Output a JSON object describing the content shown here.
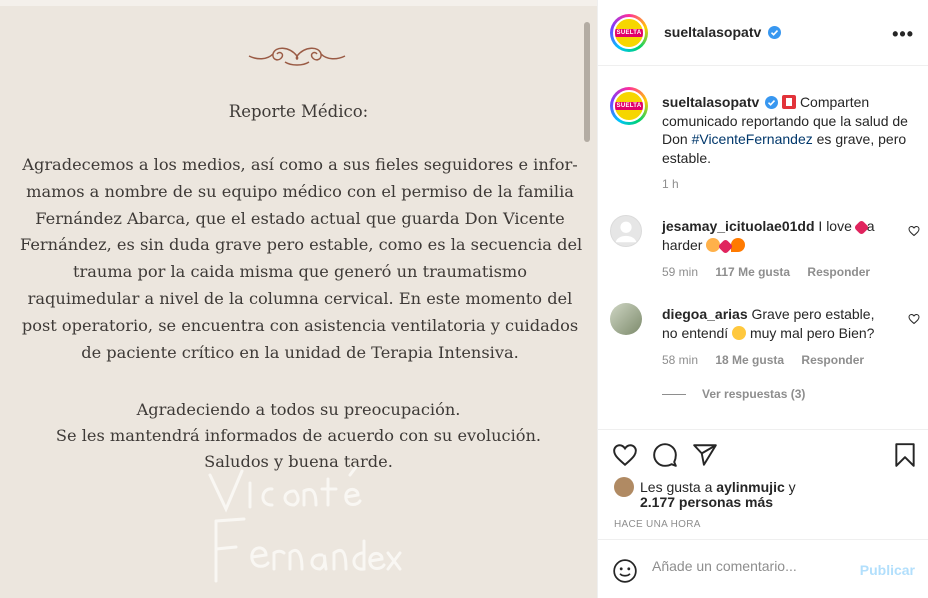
{
  "post": {
    "document": {
      "title": "Reporte Médico:",
      "body_lines": [
        "Agradecemos a los medios, así como a sus fieles seguidores e infor-",
        "mamos a nombre de su equipo médico con el permiso de la familia",
        "Fernández Abarca, que el estado actual que guarda Don Vicente",
        "Fernández, es sin duda grave pero estable, como es la secuencia del",
        "trauma por la caida misma que generó un traumatismo",
        "raquimedular a nivel de la columna cervical. En este momento del",
        "post operatorio, se encuentra con asistencia ventilatoria y cuidados",
        "de paciente crítico en la unidad de Terapia Intensiva."
      ],
      "closing_lines": [
        "Agradeciendo a todos su preocupación.",
        "Se les mantendrá informados de acuerdo con su evolución.",
        "Saludos y buena tarde."
      ],
      "signature": "Vicente Fernández"
    }
  },
  "header": {
    "username": "sueltalasopatv",
    "avatar_text": "SUELTA"
  },
  "caption": {
    "username": "sueltalasopatv",
    "text_before": "Comparten comunicado reportando que la salud de Don ",
    "hashtag": "#VicenteFernandez",
    "text_after": " es grave, pero estable.",
    "time": "1 h"
  },
  "comments": [
    {
      "username": "jesamay_icituolae01dd",
      "text_a": "I love",
      "text_b": "a harder",
      "time": "59 min",
      "likes": "117 Me gusta",
      "reply": "Responder"
    },
    {
      "username": "diegoa_arias",
      "text_a": "Grave pero estable, no entendí",
      "text_b": "muy mal pero Bien?",
      "time": "58 min",
      "likes": "18 Me gusta",
      "reply": "Responder"
    }
  ],
  "view_replies": "Ver respuestas (3)",
  "likes": {
    "liked_by_prefix": "Les gusta a ",
    "liked_by_user": "aylinmujic",
    "liked_by_suffix": " y",
    "others": "2.177 personas más"
  },
  "post_time": "HACE UNA HORA",
  "composer": {
    "placeholder": "Añade un comentario...",
    "publish": "Publicar"
  },
  "colors": {
    "accent": "#0095f6",
    "publish_disabled": "#b2dffc",
    "heart": "#ed4956",
    "doc_background": "#ece6de"
  },
  "icons": [
    "ornament-icon",
    "verified-icon",
    "more-icon",
    "heart-icon",
    "comment-icon",
    "share-icon",
    "save-icon",
    "emoji-icon"
  ]
}
